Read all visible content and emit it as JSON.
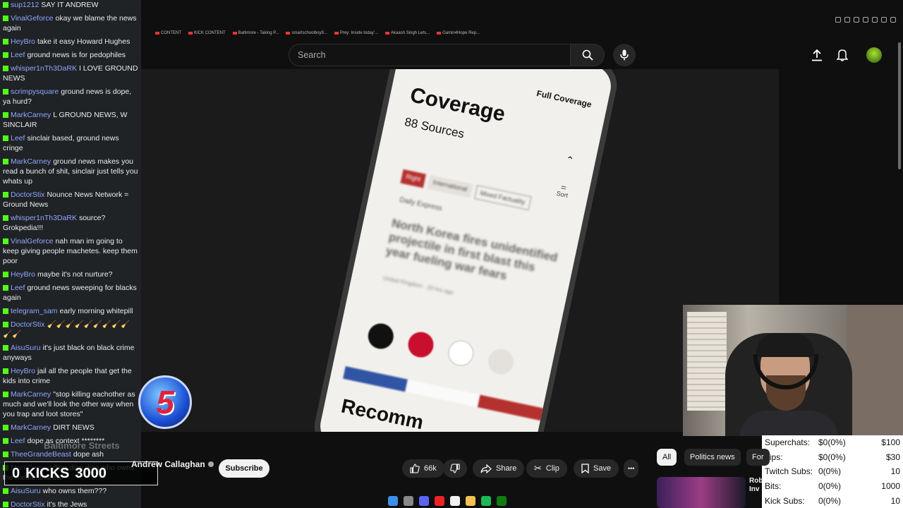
{
  "chat": {
    "messages": [
      {
        "user": "sup1212",
        "text": "SAY IT ANDREW"
      },
      {
        "user": "VinalGeforce",
        "text": "okay we blame the news again"
      },
      {
        "user": "HeyBro",
        "text": "take it easy Howard Hughes"
      },
      {
        "user": "Leef",
        "text": "ground news is for pedophiles"
      },
      {
        "user": "whisper1nTh3DaRK",
        "text": "I LOVE GROUND NEWS"
      },
      {
        "user": "scrimpysquare",
        "text": "ground news is dope, ya hurd?"
      },
      {
        "user": "MarkCarney",
        "text": "L GROUND NEWS, W SINCLAIR"
      },
      {
        "user": "Leef",
        "text": "sinclair based, ground news cringe"
      },
      {
        "user": "MarkCarney",
        "text": "ground news makes you read a bunch of shit, sinclair just tells you whats up"
      },
      {
        "user": "DoctorStix",
        "text": "Nounce News Network = Ground News"
      },
      {
        "user": "whisper1nTh3DaRK",
        "text": "source? Grokpedia!!!"
      },
      {
        "user": "VinalGeforce",
        "text": "nah man im going to keep giving people machetes. keep them poor"
      },
      {
        "user": "HeyBro",
        "text": "maybe it's not nurture?"
      },
      {
        "user": "Leef",
        "text": "ground news sweeping for blacks again"
      },
      {
        "user": "telegram_sam",
        "text": "early morning whitepill"
      },
      {
        "user": "DoctorStix",
        "text": "🧹🧹🧹🧹🧹🧹🧹🧹🧹🧹🧹"
      },
      {
        "user": "AisuSuru",
        "text": "it's just black on black crime anyways"
      },
      {
        "user": "HeyBro",
        "text": "jail all the people that get the kids into crime"
      },
      {
        "user": "MarkCarney",
        "text": "\"stop killing eachother as much and we'll look the other way when you trap and loot stores\""
      },
      {
        "user": "MarkCarney",
        "text": "DIRT NEWS"
      },
      {
        "user": "Leef",
        "text": "dope as context ********"
      },
      {
        "user": "TheeGrandeBeast",
        "text": "dope ash"
      },
      {
        "user": "MarkCarney",
        "text": "ding ding ding who owns the media andrew"
      },
      {
        "user": "AisuSuru",
        "text": "who owns them???"
      },
      {
        "user": "DoctorStix",
        "text": "it's the Jews"
      }
    ]
  },
  "bookmarks": [
    "CONTENT",
    "KICK CONTENT",
    "Baltimore - Taking P...",
    "smartschoolboy9...",
    "Prey: Inside today'...",
    "Akaash Singh Lets...",
    "Gamin4Hope Rep..."
  ],
  "youtube": {
    "search_placeholder": "Search",
    "channel": "Andrew Callaghan",
    "subscribe": "Subscribe",
    "likes": "66k",
    "share": "Share",
    "clip": "Clip",
    "save": "Save",
    "more": "•••",
    "chips": [
      "All",
      "Politics news",
      "For"
    ],
    "rec_title": "Rob\nInv"
  },
  "video": {
    "full_coverage": "Full Coverage",
    "coverage_title": "Coverage",
    "sources": "88 Sources",
    "sort": "Sort",
    "tags": [
      "Right",
      "International",
      "Mixed Factuality"
    ],
    "source_name": "Daily Express",
    "headline": "North Korea fires unidentified projectile in first blast this year fueling war fears",
    "meta": "United Kingdom · 20 hrs ago",
    "recommended": "Recomm"
  },
  "overlay": {
    "channel_logo": "5",
    "stream_title": "Baltimore Streets",
    "kicks_count": "0",
    "kicks_label": "KICKS",
    "kicks_goal": "3000"
  },
  "stats": [
    {
      "label": "Superchats:",
      "value": "$0(0%)",
      "goal": "$100"
    },
    {
      "label": "Tips:",
      "value": "$0(0%)",
      "goal": "$30"
    },
    {
      "label": "Twitch Subs:",
      "value": "0(0%)",
      "goal": "10"
    },
    {
      "label": "Bits:",
      "value": "0(0%)",
      "goal": "1000"
    },
    {
      "label": "Kick Subs:",
      "value": "0(0%)",
      "goal": "10"
    }
  ],
  "colors": {
    "accent_green": "#53fc18",
    "user_name": "#8fa7ff",
    "youtube_bg": "#0f0f0f"
  }
}
